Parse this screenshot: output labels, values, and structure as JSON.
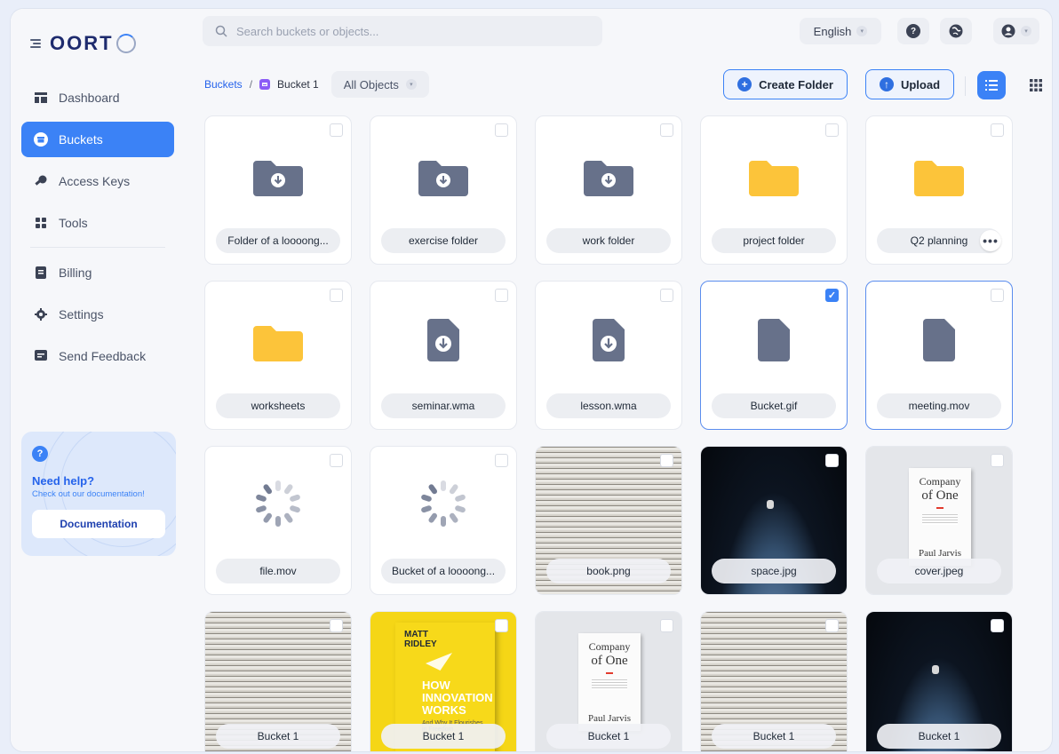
{
  "app": {
    "brand": "OORT",
    "nav": [
      {
        "label": "Dashboard",
        "icon": "dashboard-icon",
        "active": false
      },
      {
        "label": "Buckets",
        "icon": "bucket-icon",
        "active": true
      },
      {
        "label": "Access Keys",
        "icon": "key-icon",
        "active": false
      },
      {
        "label": "Tools",
        "icon": "tools-icon",
        "active": false
      },
      {
        "label": "Billing",
        "icon": "billing-icon",
        "active": false
      },
      {
        "label": "Settings",
        "icon": "gear-icon",
        "active": false
      },
      {
        "label": "Send Feedback",
        "icon": "feedback-icon",
        "active": false
      }
    ],
    "help": {
      "title": "Need help?",
      "subtitle": "Check out our documentation!",
      "button": "Documentation"
    }
  },
  "topbar": {
    "search_placeholder": "Search buckets or objects...",
    "language": "English"
  },
  "toolbar": {
    "breadcrumb_root": "Buckets",
    "breadcrumb_sep": "/",
    "breadcrumb_current": "Bucket 1",
    "filter": "All Objects",
    "create_folder": "Create Folder",
    "upload": "Upload"
  },
  "colors": {
    "accent": "#3b82f6",
    "folder_gray": "#67718a",
    "folder_yellow": "#fcc43a"
  },
  "items": [
    {
      "name": "Folder of a loooong...",
      "kind": "folder-download",
      "selected": false
    },
    {
      "name": "exercise folder",
      "kind": "folder-download",
      "selected": false
    },
    {
      "name": "work folder",
      "kind": "folder-download",
      "selected": false
    },
    {
      "name": "project folder",
      "kind": "folder-yellow",
      "selected": false
    },
    {
      "name": "Q2 planning",
      "kind": "folder-yellow",
      "selected": false,
      "more": "•••"
    },
    {
      "name": "worksheets",
      "kind": "folder-yellow",
      "selected": false
    },
    {
      "name": "seminar.wma",
      "kind": "file-download",
      "selected": false
    },
    {
      "name": "lesson.wma",
      "kind": "file-download",
      "selected": false
    },
    {
      "name": "Bucket.gif",
      "kind": "file",
      "selected": true
    },
    {
      "name": "meeting.mov",
      "kind": "file",
      "selected": false,
      "highlight": true
    },
    {
      "name": "file.mov",
      "kind": "loading",
      "selected": false
    },
    {
      "name": "Bucket of a loooong...",
      "kind": "loading",
      "selected": false
    },
    {
      "name": "book.png",
      "kind": "thumb-text",
      "selected": false
    },
    {
      "name": "space.jpg",
      "kind": "thumb-space",
      "selected": false
    },
    {
      "name": "cover.jpeg",
      "kind": "thumb-book",
      "selected": false
    },
    {
      "name": "Bucket 1",
      "kind": "thumb-text",
      "selected": false
    },
    {
      "name": "Bucket 1",
      "kind": "thumb-yellow-book",
      "selected": false
    },
    {
      "name": "Bucket 1",
      "kind": "thumb-book",
      "selected": false
    },
    {
      "name": "Bucket 1",
      "kind": "thumb-text",
      "selected": false
    },
    {
      "name": "Bucket 1",
      "kind": "thumb-space",
      "selected": false
    }
  ],
  "book_cover": {
    "title_line1": "Company",
    "title_line2": "of One",
    "author": "Paul Jarvis"
  },
  "yellow_book": {
    "author_line1": "MATT",
    "author_line2": "RIDLEY",
    "title_line1": "HOW",
    "title_line2": "INNOVATION",
    "title_line3": "WORKS",
    "subtitle": "And Why It Flourishes in Freedom"
  }
}
